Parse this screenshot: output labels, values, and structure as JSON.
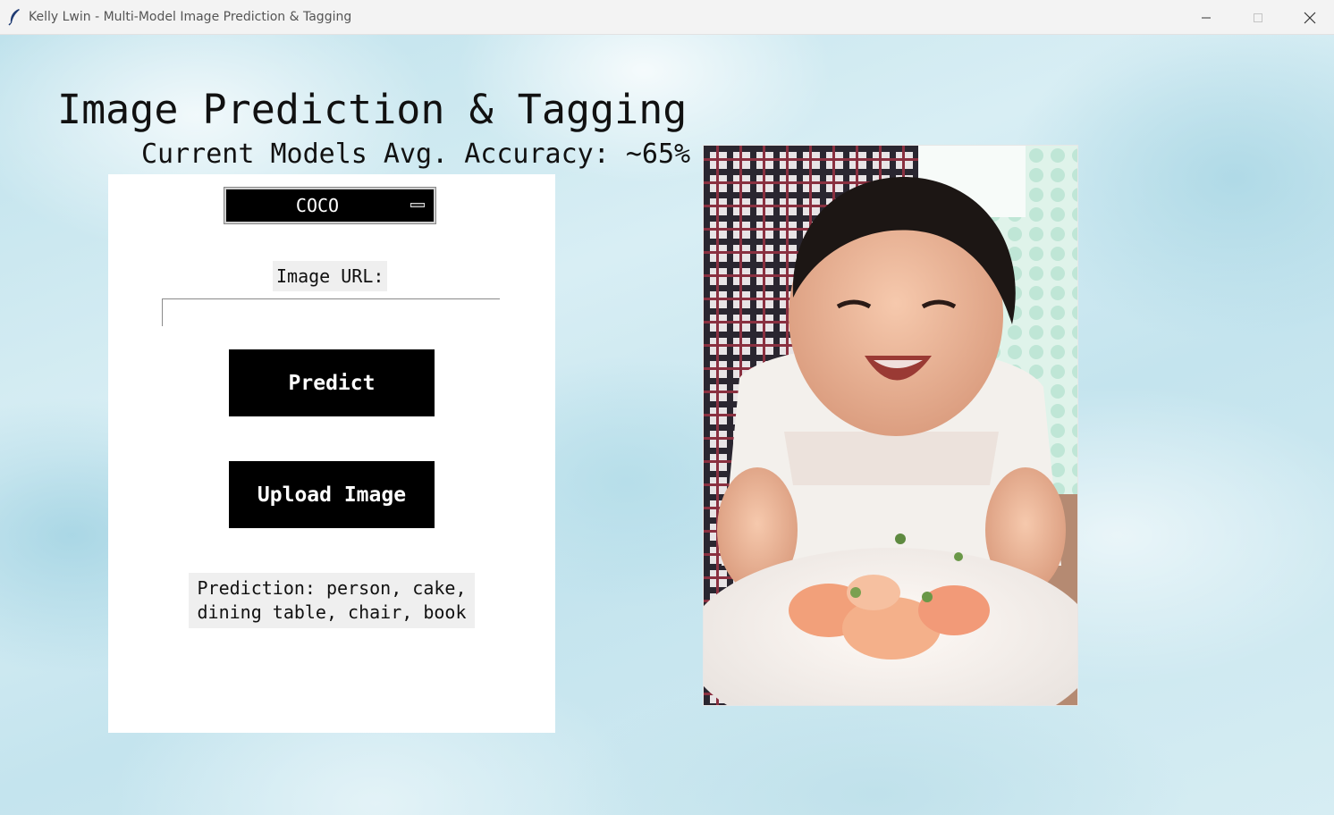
{
  "window": {
    "title": "Kelly Lwin - Multi-Model Image Prediction & Tagging"
  },
  "header": {
    "title": "Image Prediction & Tagging",
    "subtitle": "Current Models Avg. Accuracy: ~65%"
  },
  "panel": {
    "model_select": {
      "value": "COCO"
    },
    "url_label": "Image URL:",
    "url_input": {
      "value": "",
      "placeholder": ""
    },
    "predict_label": "Predict",
    "upload_label": "Upload Image",
    "prediction_text": "Prediction: person, cake, dining table, chair, book"
  },
  "colors": {
    "button_bg": "#000000",
    "panel_bg": "#ffffff",
    "label_bg": "#efefef",
    "background": "#cfe9f0"
  }
}
